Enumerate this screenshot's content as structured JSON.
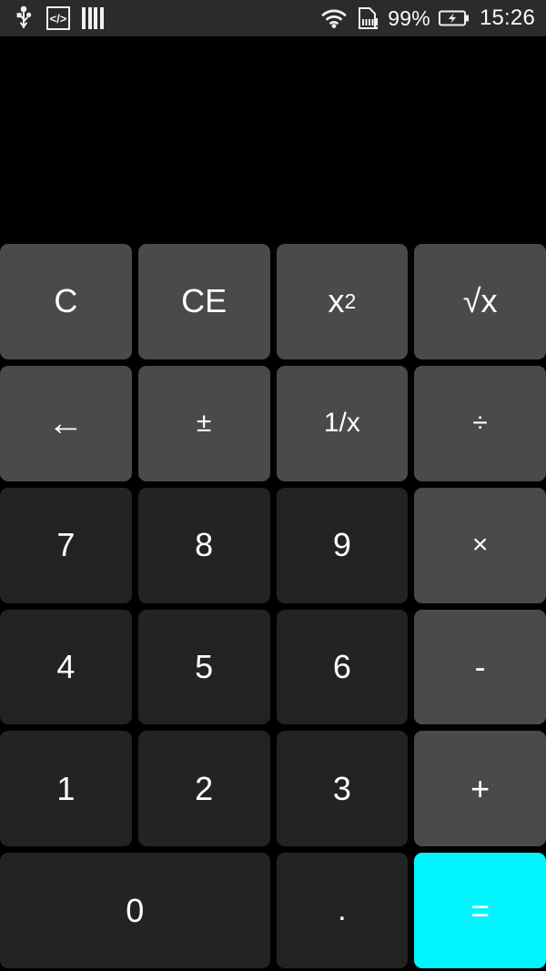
{
  "statusbar": {
    "icons_left": [
      "usb-icon",
      "developer-mode-icon",
      "bars-icon"
    ],
    "developer_label": "</>",
    "battery_percent": "99%",
    "clock": "15:26",
    "wifi": "wifi-icon",
    "sim": "sim-card-alert-icon",
    "battery": "battery-charging-icon",
    "background": "#2b2b2b"
  },
  "display": {
    "value": ""
  },
  "keypad": {
    "colors": {
      "function_key": "#4a4a4a",
      "number_key": "#232323",
      "equals_key": "#00f5ff",
      "text": "#ffffff",
      "screen": "#000000"
    },
    "keys": [
      {
        "label": "C",
        "name": "key-clear",
        "type": "fn"
      },
      {
        "label": "CE",
        "name": "key-clear-entry",
        "type": "fn"
      },
      {
        "label": "x",
        "sup": "2",
        "name": "key-square",
        "type": "fn"
      },
      {
        "label": "√x",
        "name": "key-square-root",
        "type": "fn"
      },
      {
        "label": "←",
        "name": "key-backspace",
        "type": "fn"
      },
      {
        "label": "±",
        "name": "key-plus-minus",
        "type": "fn"
      },
      {
        "label": "1/x",
        "name": "key-reciprocal",
        "type": "fn"
      },
      {
        "label": "÷",
        "name": "key-divide",
        "type": "fn"
      },
      {
        "label": "7",
        "name": "key-7",
        "type": "num"
      },
      {
        "label": "8",
        "name": "key-8",
        "type": "num"
      },
      {
        "label": "9",
        "name": "key-9",
        "type": "num"
      },
      {
        "label": "×",
        "name": "key-multiply",
        "type": "fn"
      },
      {
        "label": "4",
        "name": "key-4",
        "type": "num"
      },
      {
        "label": "5",
        "name": "key-5",
        "type": "num"
      },
      {
        "label": "6",
        "name": "key-6",
        "type": "num"
      },
      {
        "label": "-",
        "name": "key-subtract",
        "type": "fn"
      },
      {
        "label": "1",
        "name": "key-1",
        "type": "num"
      },
      {
        "label": "2",
        "name": "key-2",
        "type": "num"
      },
      {
        "label": "3",
        "name": "key-3",
        "type": "num"
      },
      {
        "label": "+",
        "name": "key-add",
        "type": "fn"
      },
      {
        "label": "0",
        "name": "key-0",
        "type": "num",
        "wide": true
      },
      {
        "label": ".",
        "name": "key-decimal",
        "type": "num"
      },
      {
        "label": "=",
        "name": "key-equals",
        "type": "eq"
      }
    ]
  }
}
